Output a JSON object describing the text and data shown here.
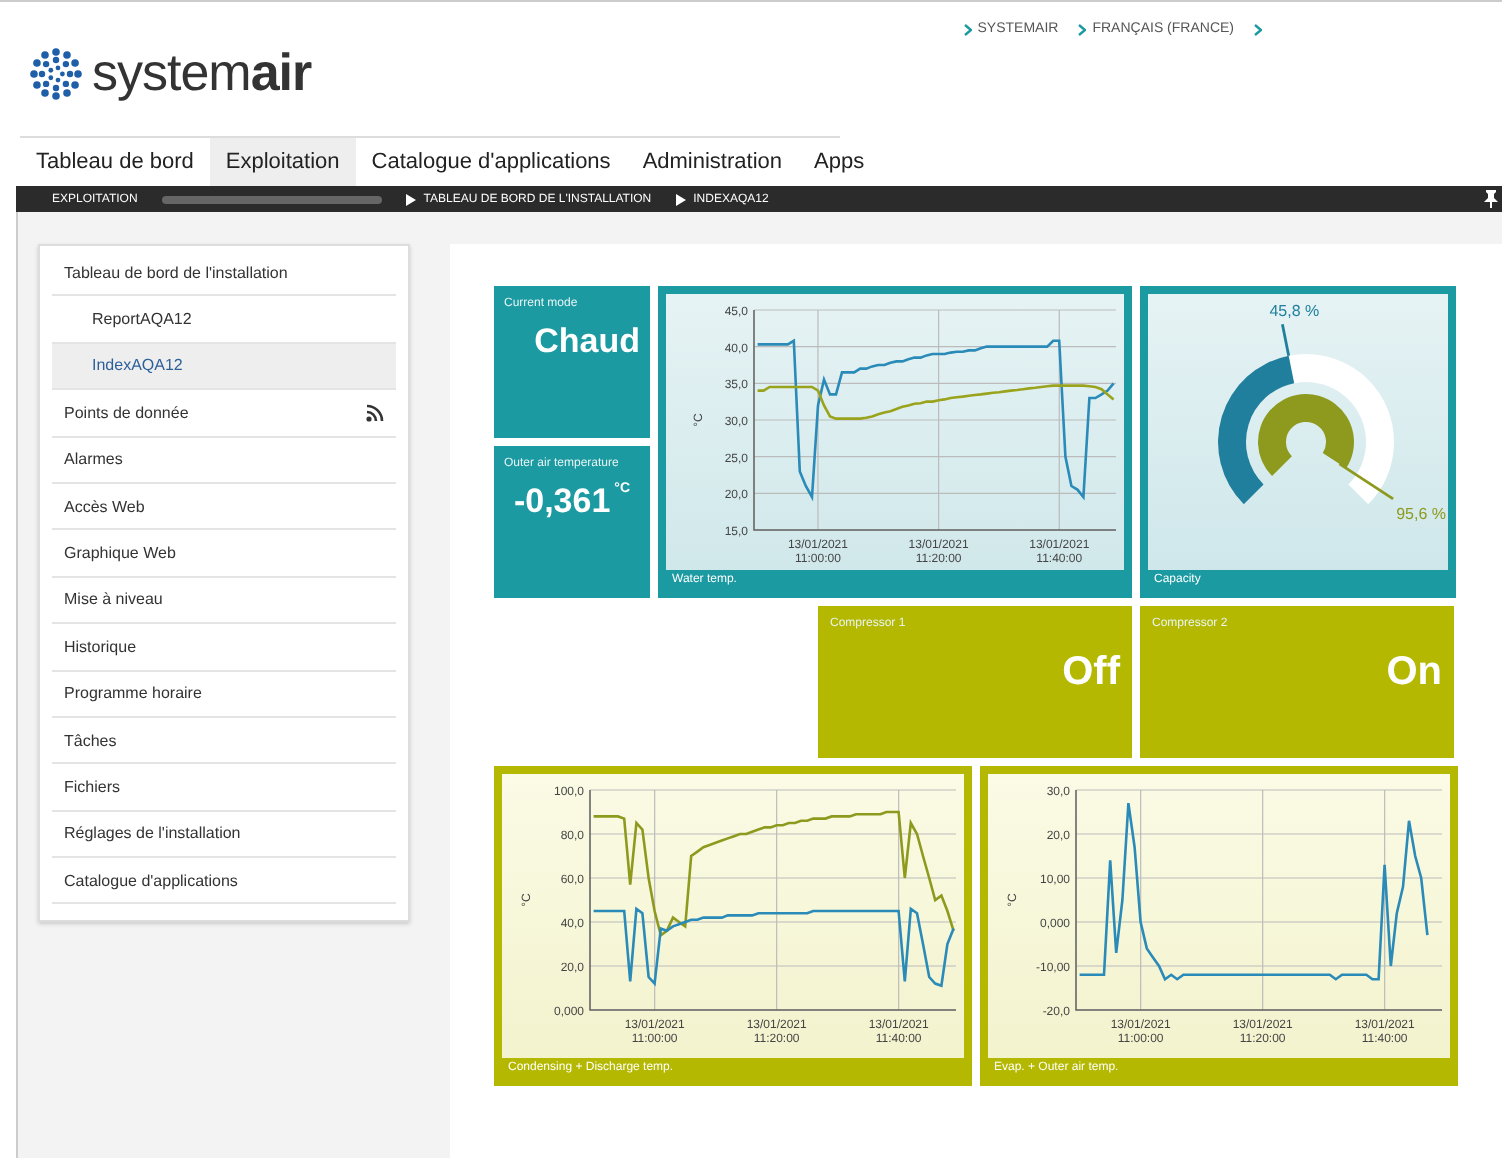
{
  "header": {
    "logo": "system**air**",
    "links": [
      {
        "kind": "text",
        "label": "SYSTEMAIR"
      },
      {
        "kind": "text",
        "label": "FRANÇAIS (FRANCE)"
      },
      {
        "kind": "icon"
      }
    ]
  },
  "tabs": [
    {
      "label": "Tableau de bord",
      "selected": false
    },
    {
      "label": "Exploitation",
      "selected": true
    },
    {
      "label": "Catalogue d'applications",
      "selected": false
    },
    {
      "label": "Administration",
      "selected": false
    },
    {
      "label": "Apps",
      "selected": false
    }
  ],
  "breadcrumb": [
    {
      "label": "EXPLOITATION",
      "kind": "root"
    },
    {
      "label": "TABLEAU DE BORD DE L'INSTALLATION",
      "kind": "step"
    },
    {
      "label": "INDEXAQA12",
      "kind": "step"
    }
  ],
  "sidebar": {
    "items": [
      {
        "label": "Tableau de bord de l'installation",
        "selected": false,
        "kind": "plain",
        "children": [
          {
            "label": "ReportAQA12",
            "selected": false
          },
          {
            "label": "IndexAQA12",
            "selected": true
          }
        ]
      },
      {
        "label": "Points de donnée",
        "selected": false,
        "kind": "feed"
      },
      {
        "label": "Alarmes",
        "selected": false,
        "kind": "plain"
      },
      {
        "label": "Accès Web",
        "selected": false,
        "kind": "plain"
      },
      {
        "label": "Graphique Web",
        "selected": false,
        "kind": "plain"
      },
      {
        "label": "Mise à niveau",
        "selected": false,
        "kind": "plain"
      },
      {
        "label": "Historique",
        "selected": false,
        "kind": "plain"
      },
      {
        "label": "Programme horaire",
        "selected": false,
        "kind": "plain"
      },
      {
        "label": "Tâches",
        "selected": false,
        "kind": "plain"
      },
      {
        "label": "Fichiers",
        "selected": false,
        "kind": "plain"
      },
      {
        "label": "Réglages de l'installation",
        "selected": false,
        "kind": "plain"
      },
      {
        "label": "Catalogue d'applications",
        "selected": false,
        "kind": "plain"
      }
    ]
  },
  "tiles": {
    "current_mode": {
      "title": "Current mode",
      "value": "Chaud",
      "color": "#1b9aa1"
    },
    "outer_air": {
      "title": "Outer air temperature",
      "value": "-0,361",
      "unit": "°C",
      "color": "#1b9aa1"
    },
    "water": {
      "caption": "Water temp.",
      "color": "#1b9aa1",
      "chart_data": {
        "type": "line",
        "grid": true,
        "ylabel": "°C",
        "ylim": [
          15,
          45
        ],
        "yticks": [
          {
            "value": 15,
            "label": "15,0"
          },
          {
            "value": 20,
            "label": "20,0"
          },
          {
            "value": 25,
            "label": "25,0"
          },
          {
            "value": 30,
            "label": "30,0"
          },
          {
            "value": 35,
            "label": "35,0"
          },
          {
            "value": 40,
            "label": "40,0"
          },
          {
            "value": 45,
            "label": "45,0"
          }
        ],
        "categories": [
          null,
          null,
          null,
          null,
          null,
          null,
          null,
          null,
          null,
          null,
          "13/01/2021 11:00:00",
          null,
          null,
          null,
          null,
          null,
          null,
          null,
          null,
          null,
          null,
          null,
          null,
          null,
          null,
          null,
          null,
          null,
          null,
          null,
          "13/01/2021 11:20:00",
          null,
          null,
          null,
          null,
          null,
          null,
          null,
          null,
          null,
          null,
          null,
          null,
          null,
          null,
          null,
          null,
          null,
          null,
          null,
          "13/01/2021 11:40:00",
          null,
          null,
          null,
          null,
          null,
          null,
          null,
          null,
          null
        ],
        "series": [
          {
            "color": "#2a8ab8",
            "values": [
              40.3,
              40.3,
              40.3,
              40.3,
              40.3,
              40.3,
              40.8,
              23,
              21,
              19.5,
              32,
              35.5,
              33.5,
              33.5,
              36.5,
              36.5,
              36.5,
              37,
              37,
              37.3,
              37.5,
              37.5,
              37.8,
              38,
              38,
              38.3,
              38.5,
              38.5,
              38.8,
              39,
              39,
              39,
              39.2,
              39.3,
              39.3,
              39.5,
              39.5,
              39.8,
              40,
              40,
              40,
              40,
              40,
              40,
              40,
              40,
              40,
              40,
              40,
              40.8,
              40.8,
              25,
              21,
              20.5,
              19.5,
              33,
              33,
              33.5,
              34,
              35
            ]
          },
          {
            "color": "#9aa31c",
            "values": [
              34,
              34,
              34.5,
              34.5,
              34.5,
              34.5,
              34.5,
              34.5,
              34.5,
              34.5,
              34,
              32,
              30.5,
              30.2,
              30.2,
              30.2,
              30.2,
              30.2,
              30.3,
              30.5,
              30.8,
              31,
              31.2,
              31.5,
              31.8,
              32,
              32.2,
              32.3,
              32.5,
              32.5,
              32.7,
              32.8,
              33,
              33.1,
              33.2,
              33.3,
              33.4,
              33.5,
              33.6,
              33.7,
              33.8,
              33.9,
              34,
              34.1,
              34.2,
              34.3,
              34.4,
              34.5,
              34.6,
              34.7,
              34.7,
              34.7,
              34.7,
              34.7,
              34.7,
              34.6,
              34.5,
              34.2,
              33.5,
              32.8
            ]
          }
        ]
      }
    },
    "capacity": {
      "caption": "Capacity",
      "color": "#1b9aa1",
      "outer": {
        "reading": "45,8  %",
        "color": "#1f7f9c"
      },
      "inner": {
        "reading": "95,6  %",
        "color": "#8e9a1e"
      }
    },
    "compressors": [
      {
        "title": "Compressor 1",
        "value": "Off",
        "color": "#b5b800"
      },
      {
        "title": "Compressor 2",
        "value": "On",
        "color": "#b5b800"
      }
    ],
    "bottom_charts": [
      {
        "caption": "Condensing + Discharge temp.",
        "color": "#b5b800",
        "chart_data": {
          "type": "line",
          "grid": true,
          "ylabel": "°C",
          "ylim": [
            0,
            100
          ],
          "yticks": [
            {
              "value": 0,
              "label": "0,000"
            },
            {
              "value": 20,
              "label": "20,0"
            },
            {
              "value": 40,
              "label": "40,0"
            },
            {
              "value": 60,
              "label": "60,0"
            },
            {
              "value": 80,
              "label": "80,0"
            },
            {
              "value": 100,
              "label": "100,0"
            }
          ],
          "categories": [
            null,
            null,
            null,
            null,
            null,
            null,
            null,
            null,
            null,
            null,
            "13/01/2021 11:00:00",
            null,
            null,
            null,
            null,
            null,
            null,
            null,
            null,
            null,
            null,
            null,
            null,
            null,
            null,
            null,
            null,
            null,
            null,
            null,
            "13/01/2021 11:20:00",
            null,
            null,
            null,
            null,
            null,
            null,
            null,
            null,
            null,
            null,
            null,
            null,
            null,
            null,
            null,
            null,
            null,
            null,
            null,
            "13/01/2021 11:40:00",
            null,
            null,
            null,
            null,
            null,
            null,
            null,
            null,
            null
          ],
          "series": [
            {
              "color": "#8e9a1e",
              "values": [
                88,
                88,
                88,
                88,
                88,
                87,
                57,
                85,
                82,
                60,
                45,
                34,
                36,
                42,
                40,
                38,
                70,
                72,
                74,
                75,
                76,
                77,
                78,
                79,
                80,
                80,
                81,
                82,
                83,
                83,
                84,
                84,
                85,
                85,
                86,
                86,
                87,
                87,
                87,
                88,
                88,
                88,
                88,
                89,
                89,
                89,
                89,
                89,
                90,
                90,
                90,
                60,
                85,
                80,
                70,
                60,
                50,
                52,
                45,
                36
              ]
            },
            {
              "color": "#2a8ab8",
              "values": [
                45,
                45,
                45,
                45,
                45,
                45,
                13,
                46,
                44,
                15,
                12,
                37,
                36,
                38,
                39,
                40,
                41,
                41,
                42,
                42,
                42,
                42,
                43,
                43,
                43,
                43,
                43,
                44,
                44,
                44,
                44,
                44,
                44,
                44,
                44,
                44,
                45,
                45,
                45,
                45,
                45,
                45,
                45,
                45,
                45,
                45,
                45,
                45,
                45,
                45,
                45,
                13,
                46,
                44,
                30,
                15,
                12,
                11,
                30,
                37
              ]
            }
          ]
        }
      },
      {
        "caption": "Evap. + Outer air temp.",
        "color": "#b5b800",
        "chart_data": {
          "type": "line",
          "grid": true,
          "ylabel": "°C",
          "ylim": [
            -20,
            30
          ],
          "yticks": [
            {
              "value": -20,
              "label": "-20,0"
            },
            {
              "value": -10,
              "label": "-10,00"
            },
            {
              "value": 0,
              "label": "0,000"
            },
            {
              "value": 10,
              "label": "10,00"
            },
            {
              "value": 20,
              "label": "20,0"
            },
            {
              "value": 30,
              "label": "30,0"
            }
          ],
          "categories": [
            null,
            null,
            null,
            null,
            null,
            null,
            null,
            null,
            null,
            null,
            "13/01/2021 11:00:00",
            null,
            null,
            null,
            null,
            null,
            null,
            null,
            null,
            null,
            null,
            null,
            null,
            null,
            null,
            null,
            null,
            null,
            null,
            null,
            "13/01/2021 11:20:00",
            null,
            null,
            null,
            null,
            null,
            null,
            null,
            null,
            null,
            null,
            null,
            null,
            null,
            null,
            null,
            null,
            null,
            null,
            null,
            "13/01/2021 11:40:00",
            null,
            null,
            null,
            null,
            null,
            null,
            null,
            null,
            null
          ],
          "series": [
            {
              "color": "#2a8ab8",
              "values": [
                -12,
                -12,
                -12,
                -12,
                -12,
                14,
                -7,
                5,
                27,
                17,
                0,
                -6,
                -8,
                -10,
                -13,
                -12,
                -13,
                -12,
                -12,
                -12,
                -12,
                -12,
                -12,
                -12,
                -12,
                -12,
                -12,
                -12,
                -12,
                -12,
                -12,
                -12,
                -12,
                -12,
                -12,
                -12,
                -12,
                -12,
                -12,
                -12,
                -12,
                -12,
                -13,
                -12,
                -12,
                -12,
                -12,
                -12,
                -13,
                -13,
                13,
                -10,
                2,
                8,
                23,
                15,
                10,
                -3,
                null,
                null
              ]
            }
          ]
        }
      }
    ]
  }
}
